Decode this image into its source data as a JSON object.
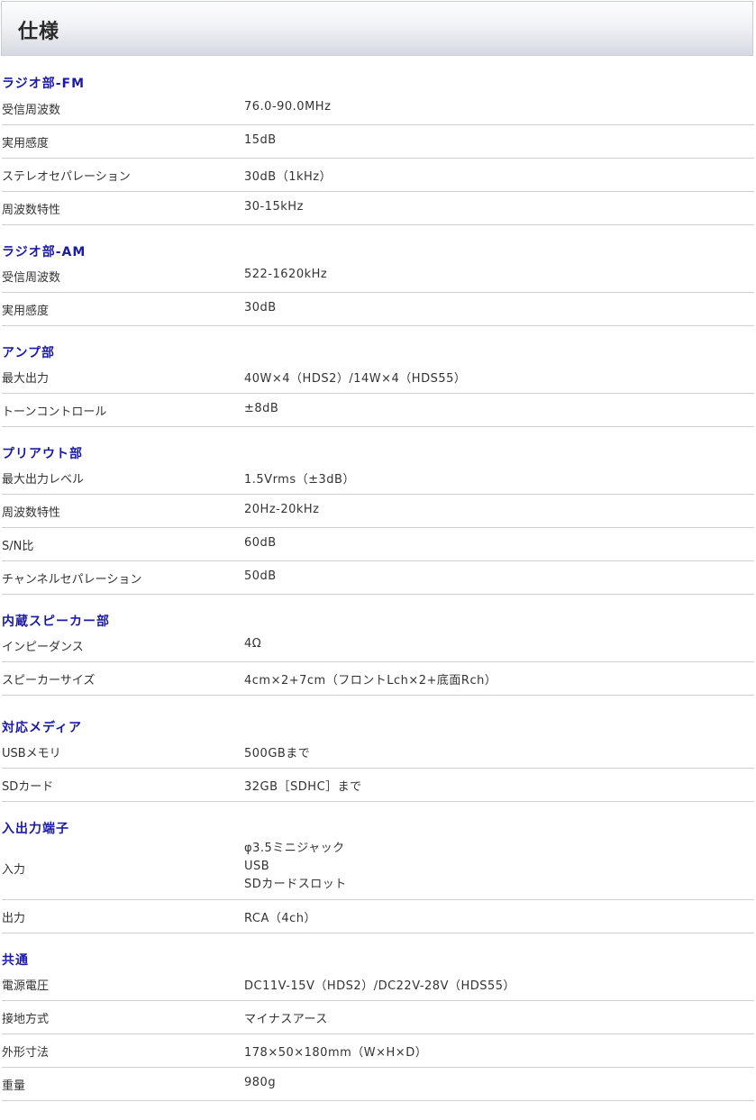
{
  "page": {
    "title": "仕様"
  },
  "sections": [
    {
      "title": "ラジオ部-FM",
      "rows": [
        {
          "label": "受信周波数",
          "value": "76.0-90.0MHz"
        },
        {
          "label": "実用感度",
          "value": "15dB"
        },
        {
          "label": "ステレオセパレーション",
          "value": "30dB（1kHz）"
        },
        {
          "label": "周波数特性",
          "value": "30-15kHz"
        }
      ]
    },
    {
      "title": "ラジオ部-AM",
      "rows": [
        {
          "label": "受信周波数",
          "value": "522-1620kHz"
        },
        {
          "label": "実用感度",
          "value": "30dB"
        }
      ]
    },
    {
      "title": "アンプ部",
      "rows": [
        {
          "label": "最大出力",
          "value": "40W×4（HDS2）/14W×4（HDS55）"
        },
        {
          "label": "トーンコントロール",
          "value": "±8dB"
        }
      ]
    },
    {
      "title": "プリアウト部",
      "rows": [
        {
          "label": "最大出力レベル",
          "value": "1.5Vrms（±3dB）"
        },
        {
          "label": "周波数特性",
          "value": "20Hz-20kHz"
        },
        {
          "label": "S/N比",
          "value": "60dB"
        },
        {
          "label": "チャンネルセパレーション",
          "value": "50dB"
        }
      ]
    },
    {
      "title": "内蔵スピーカー部",
      "rows": [
        {
          "label": "インピーダンス",
          "value": "4Ω"
        },
        {
          "label": "スピーカーサイズ",
          "value": "4cm×2+7cm（フロントLch×2+底面Rch）"
        }
      ]
    },
    {
      "title": "対応メディア",
      "rows": [
        {
          "label": "USBメモリ",
          "value": "500GBまで"
        },
        {
          "label": "SDカード",
          "value": "32GB［SDHC］まで"
        }
      ]
    },
    {
      "title": "入出力端子",
      "rows": [
        {
          "label": "入力",
          "values": [
            "φ3.5ミニジャック",
            "USB",
            "SDカードスロット"
          ]
        },
        {
          "label": "出力",
          "value": "RCA（4ch）"
        }
      ]
    },
    {
      "title": "共通",
      "rows": [
        {
          "label": "電源電圧",
          "value": "DC11V-15V（HDS2）/DC22V-28V（HDS55）"
        },
        {
          "label": "接地方式",
          "value": "マイナスアース"
        },
        {
          "label": "外形寸法",
          "value": "178×50×180mm（W×H×D）"
        },
        {
          "label": "重量",
          "value": "980g"
        }
      ]
    }
  ]
}
